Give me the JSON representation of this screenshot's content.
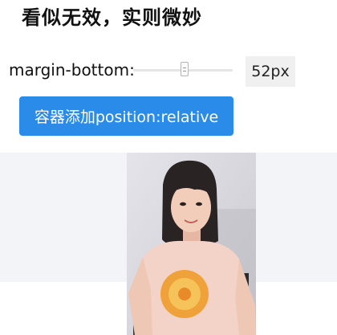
{
  "page": {
    "title": "看似无效，实则微妙"
  },
  "control": {
    "label": "margin-bottom:",
    "value_text": "52px",
    "slider_level": 0.52
  },
  "button": {
    "label": "容器添加position:relative"
  },
  "photo": {
    "subject": "selfie-photo"
  },
  "colors": {
    "accent": "#2a8ce8",
    "band": "#f3f4f8",
    "value_box": "#f0f0f0"
  }
}
